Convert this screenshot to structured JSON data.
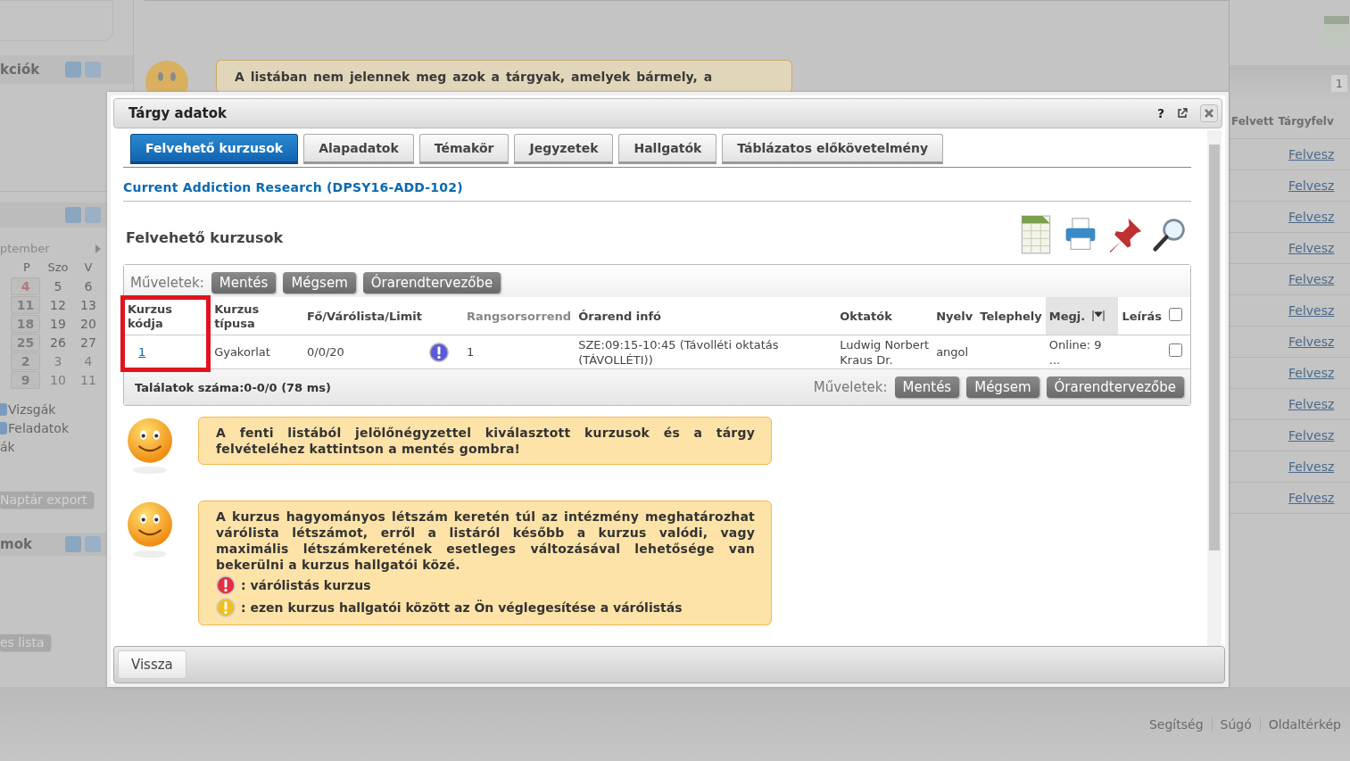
{
  "background": {
    "actions_panel": {
      "title": "kciók"
    },
    "calendar": {
      "month": "ptember",
      "weekdays": [
        "P",
        "Szo",
        "V"
      ],
      "weeks": [
        [
          {
            "day": "4",
            "kind": "today"
          },
          {
            "day": "5",
            "kind": "normal"
          },
          {
            "day": "6",
            "kind": "normal"
          }
        ],
        [
          {
            "day": "11",
            "kind": "marked"
          },
          {
            "day": "12",
            "kind": "normal"
          },
          {
            "day": "13",
            "kind": "normal"
          }
        ],
        [
          {
            "day": "18",
            "kind": "marked"
          },
          {
            "day": "19",
            "kind": "normal"
          },
          {
            "day": "20",
            "kind": "normal"
          }
        ],
        [
          {
            "day": "25",
            "kind": "marked"
          },
          {
            "day": "26",
            "kind": "normal"
          },
          {
            "day": "27",
            "kind": "normal"
          }
        ],
        [
          {
            "day": "2",
            "kind": "marked"
          },
          {
            "day": "3",
            "kind": "other"
          },
          {
            "day": "4",
            "kind": "other"
          }
        ],
        [
          {
            "day": "9",
            "kind": "marked"
          },
          {
            "day": "10",
            "kind": "other"
          },
          {
            "day": "11",
            "kind": "other"
          }
        ]
      ],
      "filters": [
        {
          "label": "Vizsgák",
          "checked": true
        },
        {
          "label": "Feladatok",
          "checked": true
        },
        {
          "label": "ák",
          "checked": false
        }
      ],
      "export_button": "Naptár export"
    },
    "lower_panel": {
      "title": "mok",
      "button": "es lista"
    },
    "top_note": "A listában nem jelennek meg azok a tárgyak, amelyek bármely, a",
    "right_table": {
      "page": "1",
      "columns": [
        "Felvett",
        "Tárgyfelv"
      ],
      "links": [
        "Felvesz",
        "Felvesz",
        "Felvesz",
        "Felvesz",
        "Felvesz",
        "Felvesz",
        "Felvesz",
        "Felvesz",
        "Felvesz",
        "Felvesz",
        "Felvesz",
        "Felvesz"
      ]
    },
    "footer_links": [
      "Segítség",
      "Súgó",
      "Oldaltérkép"
    ]
  },
  "dialog": {
    "title": "Tárgy adatok",
    "help": "?",
    "tabs": [
      {
        "label": "Felvehető kurzusok",
        "selected": true
      },
      {
        "label": "Alapadatok",
        "selected": false
      },
      {
        "label": "Témakör",
        "selected": false
      },
      {
        "label": "Jegyzetek",
        "selected": false
      },
      {
        "label": "Hallgatók",
        "selected": false
      },
      {
        "label": "Táblázatos előkövetelmény",
        "selected": false
      }
    ],
    "subject_link": "Current Addiction Research (DPSY16-ADD-102)",
    "section_title": "Felvehető kurzusok",
    "actions_label": "Műveletek:",
    "action_buttons": [
      "Mentés",
      "Mégsem",
      "Órarendtervezőbe"
    ],
    "table": {
      "columns": [
        {
          "label": "Kurzus kódja",
          "highlighted": true,
          "muted": false,
          "filter": false
        },
        {
          "label": "Kurzus típusa",
          "highlighted": false,
          "muted": false,
          "filter": false
        },
        {
          "label": "Fő/Várólista/Limit",
          "highlighted": false,
          "muted": false,
          "filter": false
        },
        {
          "label": "Rangsorsorrend",
          "highlighted": false,
          "muted": true,
          "filter": false
        },
        {
          "label": "Órarend infó",
          "highlighted": false,
          "muted": false,
          "filter": false
        },
        {
          "label": "Oktatók",
          "highlighted": false,
          "muted": false,
          "filter": false
        },
        {
          "label": "Nyelv",
          "highlighted": false,
          "muted": false,
          "filter": false
        },
        {
          "label": "Telephely",
          "highlighted": false,
          "muted": false,
          "filter": false
        },
        {
          "label": "Megj.",
          "highlighted": false,
          "muted": false,
          "filter": true
        },
        {
          "label": "Leírás",
          "highlighted": false,
          "muted": false,
          "filter": false
        }
      ],
      "select_all": false,
      "rows": [
        {
          "code": "1",
          "type": "Gyakorlat",
          "counts": "0/0/20",
          "kind": "info",
          "rank": "1",
          "schedule": "SZE:09:15-10:45 (Távolléti oktatás (TÁVOLLÉTI))",
          "teachers": [
            "Ludwig Norbert",
            "Kraus Dr."
          ],
          "language": "angol",
          "note": "Online: 9 ...",
          "checked": false
        }
      ]
    },
    "result_count": "Találatok száma:0-0/0 (78 ms)",
    "bottom_actions_label": "Műveletek:",
    "bottom_action_buttons": [
      "Mentés",
      "Mégsem",
      "Órarendtervezőbe"
    ],
    "notes": [
      {
        "text": "A fenti listából jelölőnégyzettel kiválasztott kurzusok és a tárgy felvételéhez kattintson a mentés gombra!"
      },
      {
        "text": "A kurzus hagyományos létszám keretén túl az intézmény meghatározhat várólista létszámot, erről a listáról később a kurzus valódi, vagy maximális létszámkeretének esetleges változásával lehetősége van bekerülni a kurzus hallgatói közé.",
        "legend": [
          {
            "kind": "error",
            "text": ": várólistás kurzus"
          },
          {
            "kind": "warning",
            "text": ": ezen kurzus hallgatói között az Ön véglegesítése a várólistás"
          }
        ]
      }
    ],
    "back_button": "Vissza"
  }
}
